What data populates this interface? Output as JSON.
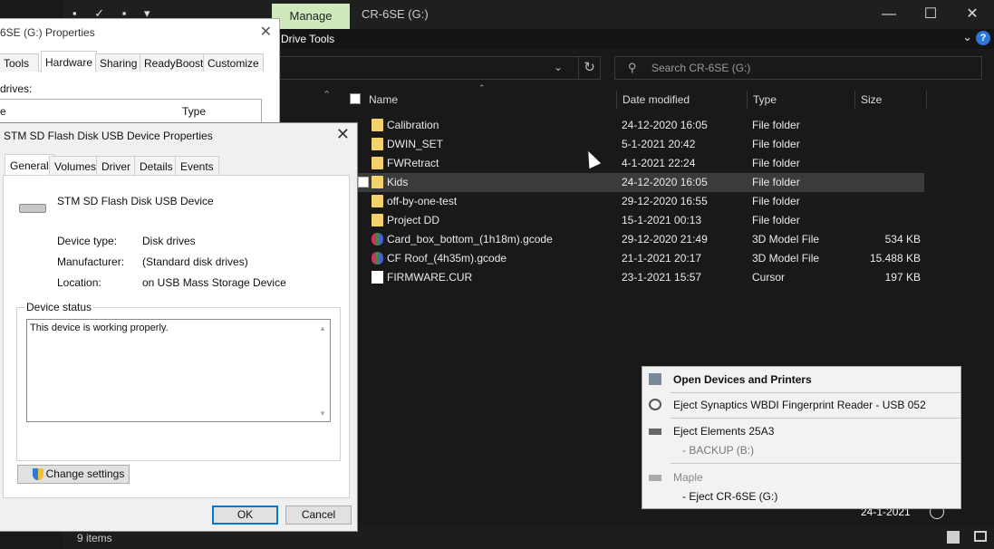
{
  "explorer": {
    "title": "CR-6SE (G:)",
    "manage_tab": "Manage",
    "drive_tools": "Drive Tools",
    "search_placeholder": "Search CR-6SE (G:)",
    "columns": {
      "name": "Name",
      "date": "Date modified",
      "type": "Type",
      "size": "Size"
    },
    "files": [
      {
        "name": "Calibration",
        "date": "24-12-2020 16:05",
        "type": "File folder",
        "size": "",
        "icon": "folder-icon"
      },
      {
        "name": "DWIN_SET",
        "date": "5-1-2021 20:42",
        "type": "File folder",
        "size": "",
        "icon": "folder-icon"
      },
      {
        "name": "FWRetract",
        "date": "4-1-2021 22:24",
        "type": "File folder",
        "size": "",
        "icon": "folder-icon"
      },
      {
        "name": "Kids",
        "date": "24-12-2020 16:05",
        "type": "File folder",
        "size": "",
        "icon": "folder-icon"
      },
      {
        "name": "off-by-one-test",
        "date": "29-12-2020 16:55",
        "type": "File folder",
        "size": "",
        "icon": "folder-icon"
      },
      {
        "name": "Project DD",
        "date": "15-1-2021 00:13",
        "type": "File folder",
        "size": "",
        "icon": "folder-icon"
      },
      {
        "name": "Card_box_bottom_(1h18m).gcode",
        "date": "29-12-2020 21:49",
        "type": "3D Model File",
        "size": "534 KB",
        "icon": "gcode-file-icon"
      },
      {
        "name": "CF Roof_(4h35m).gcode",
        "date": "21-1-2021 20:17",
        "type": "3D Model File",
        "size": "15.488 KB",
        "icon": "gcode-file-icon"
      },
      {
        "name": "FIRMWARE.CUR",
        "date": "23-1-2021 15:57",
        "type": "Cursor",
        "size": "197 KB",
        "icon": "file-icon"
      }
    ],
    "status": "9 items"
  },
  "props_bg": {
    "title": "6SE (G:) Properties",
    "tabs": [
      "Tools",
      "Hardware",
      "Sharing",
      "ReadyBoost",
      "Customize"
    ],
    "drives_label": "drives:",
    "list_col_name": "e",
    "list_col_type": "Type"
  },
  "dialog": {
    "title": "STM SD Flash Disk USB Device Properties",
    "tabs": [
      "General",
      "Volumes",
      "Driver",
      "Details",
      "Events"
    ],
    "device_name": "STM SD Flash Disk USB Device",
    "device_type_label": "Device type:",
    "device_type": "Disk drives",
    "manufacturer_label": "Manufacturer:",
    "manufacturer": "(Standard disk drives)",
    "location_label": "Location:",
    "location": "on USB Mass Storage Device",
    "status_legend": "Device status",
    "status_text": "This device is working properly.",
    "change_settings": "Change settings",
    "ok": "OK",
    "cancel": "Cancel"
  },
  "flyout": {
    "open_devices": "Open Devices and Printers",
    "eject_fingerprint": "Eject Synaptics WBDI Fingerprint Reader - USB 052",
    "eject_elements": "Eject Elements 25A3",
    "backup": "-  BACKUP (B:)",
    "maple": "Maple",
    "eject_cr6se": "-  Eject CR-6SE (G:)"
  },
  "taskbar": {
    "date": "24-1-2021"
  }
}
